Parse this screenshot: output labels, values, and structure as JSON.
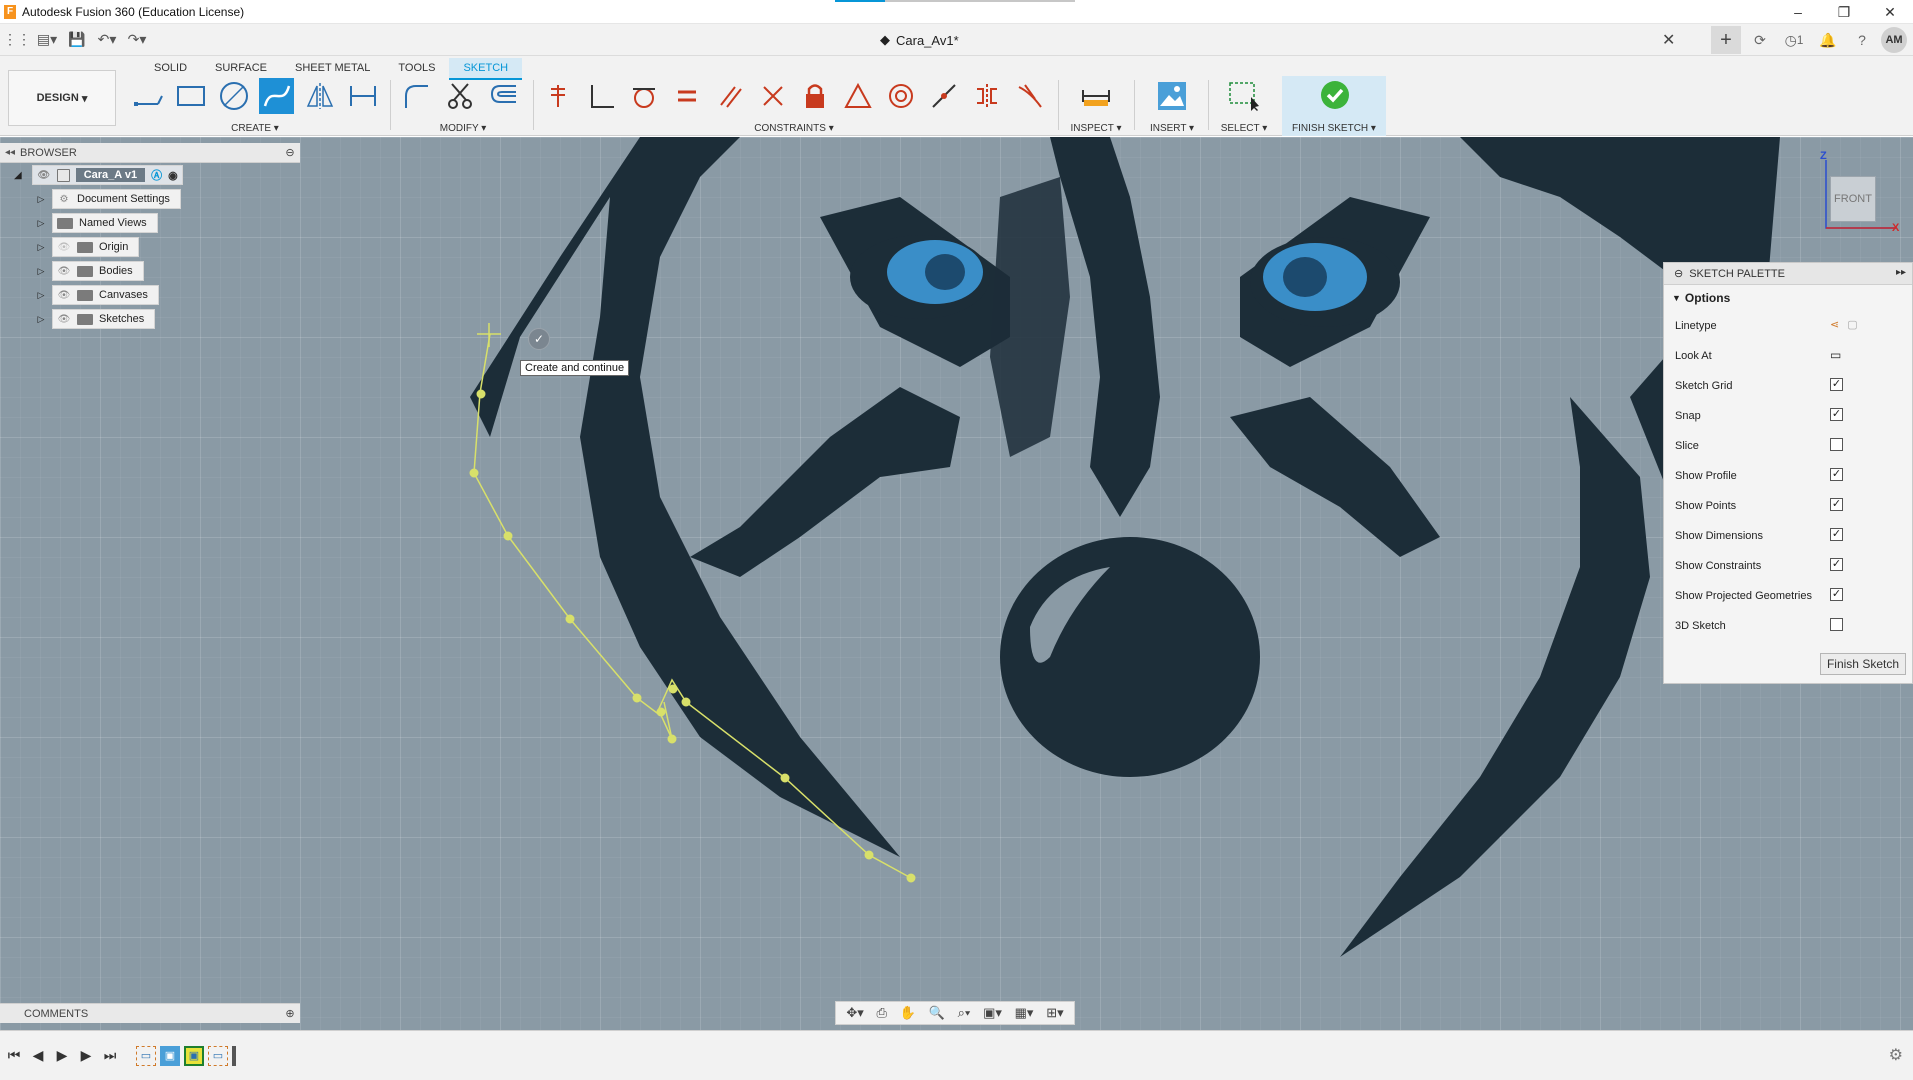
{
  "window": {
    "title": "Autodesk Fusion 360 (Education License)",
    "controls": [
      "–",
      "❐",
      "✕"
    ]
  },
  "document_tab": {
    "name": "Cara_Av1*",
    "notification_count": "1",
    "user_initials": "AM"
  },
  "toolbar": {
    "workspace": "DESIGN",
    "mode_tabs": [
      "SOLID",
      "SURFACE",
      "SHEET METAL",
      "TOOLS",
      "SKETCH"
    ],
    "active_mode": "SKETCH",
    "groups": {
      "create": "CREATE",
      "modify": "MODIFY",
      "constraints": "CONSTRAINTS",
      "inspect": "INSPECT",
      "insert": "INSERT",
      "select": "SELECT",
      "finish": "FINISH SKETCH"
    }
  },
  "browser": {
    "title": "BROWSER",
    "root": "Cara_A v1",
    "items": [
      {
        "label": "Document Settings",
        "icon": "gear-icon"
      },
      {
        "label": "Named Views",
        "icon": "folder-icon"
      },
      {
        "label": "Origin",
        "icon": "folder-icon"
      },
      {
        "label": "Bodies",
        "icon": "folder-icon"
      },
      {
        "label": "Canvases",
        "icon": "folder-icon"
      },
      {
        "label": "Sketches",
        "icon": "folder-icon"
      }
    ]
  },
  "tooltip": {
    "text": "Create and continue"
  },
  "viewcube": {
    "face": "FRONT",
    "z_label": "Z",
    "x_label": "X"
  },
  "sketch_palette": {
    "title": "SKETCH PALETTE",
    "section": "Options",
    "rows": [
      {
        "label": "Linetype",
        "type": "icons"
      },
      {
        "label": "Look At",
        "type": "icon"
      },
      {
        "label": "Sketch Grid",
        "checked": true
      },
      {
        "label": "Snap",
        "checked": true
      },
      {
        "label": "Slice",
        "checked": false
      },
      {
        "label": "Show Profile",
        "checked": true
      },
      {
        "label": "Show Points",
        "checked": true
      },
      {
        "label": "Show Dimensions",
        "checked": true
      },
      {
        "label": "Show Constraints",
        "checked": true
      },
      {
        "label": "Show Projected Geometries",
        "checked": true
      },
      {
        "label": "3D Sketch",
        "checked": false
      }
    ],
    "finish_button": "Finish Sketch"
  },
  "comments": {
    "title": "COMMENTS"
  },
  "colors": {
    "accent": "#0696d7",
    "canvas": "#8a9aa5",
    "artwork_dark": "#1c2d38",
    "eye_blue": "#3a8ec8",
    "spline": "#d8e06a"
  }
}
